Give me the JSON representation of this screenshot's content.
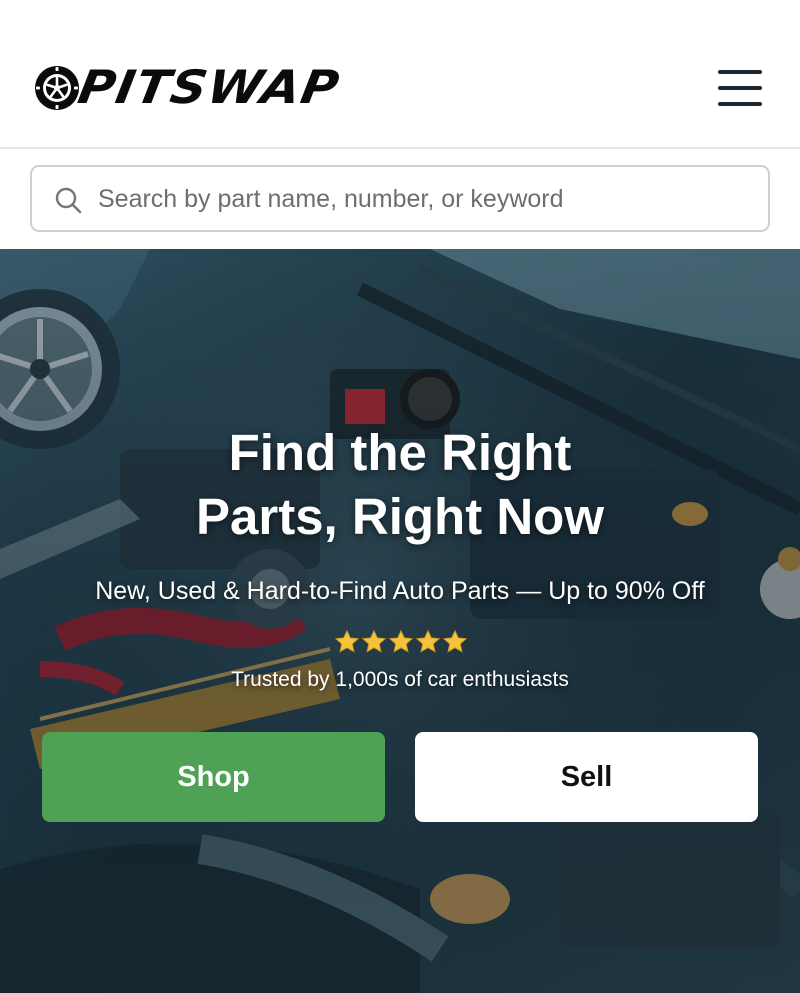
{
  "header": {
    "brand": "PITSWAP",
    "logo_icon": "tire-wheel-icon",
    "menu_icon": "hamburger-menu-icon"
  },
  "search": {
    "icon": "search-icon",
    "placeholder": "Search by part name, number, or keyword",
    "value": ""
  },
  "hero": {
    "title_line1": "Find the Right",
    "title_line2": "Parts, Right Now",
    "subtitle": "New, Used & Hard-to-Find Auto Parts — Up to 90% Off",
    "rating_stars": 5,
    "trust_text": "Trusted by 1,000s of car enthusiasts",
    "background_image": "car-engine-bay-photo"
  },
  "buttons": {
    "shop_label": "Shop",
    "sell_label": "Sell"
  },
  "colors": {
    "brand_text": "#0b0b0b",
    "shop_button": "#4fa155",
    "sell_button": "#ffffff",
    "star": "#f5c33b",
    "menu_icon": "#1f2733"
  }
}
